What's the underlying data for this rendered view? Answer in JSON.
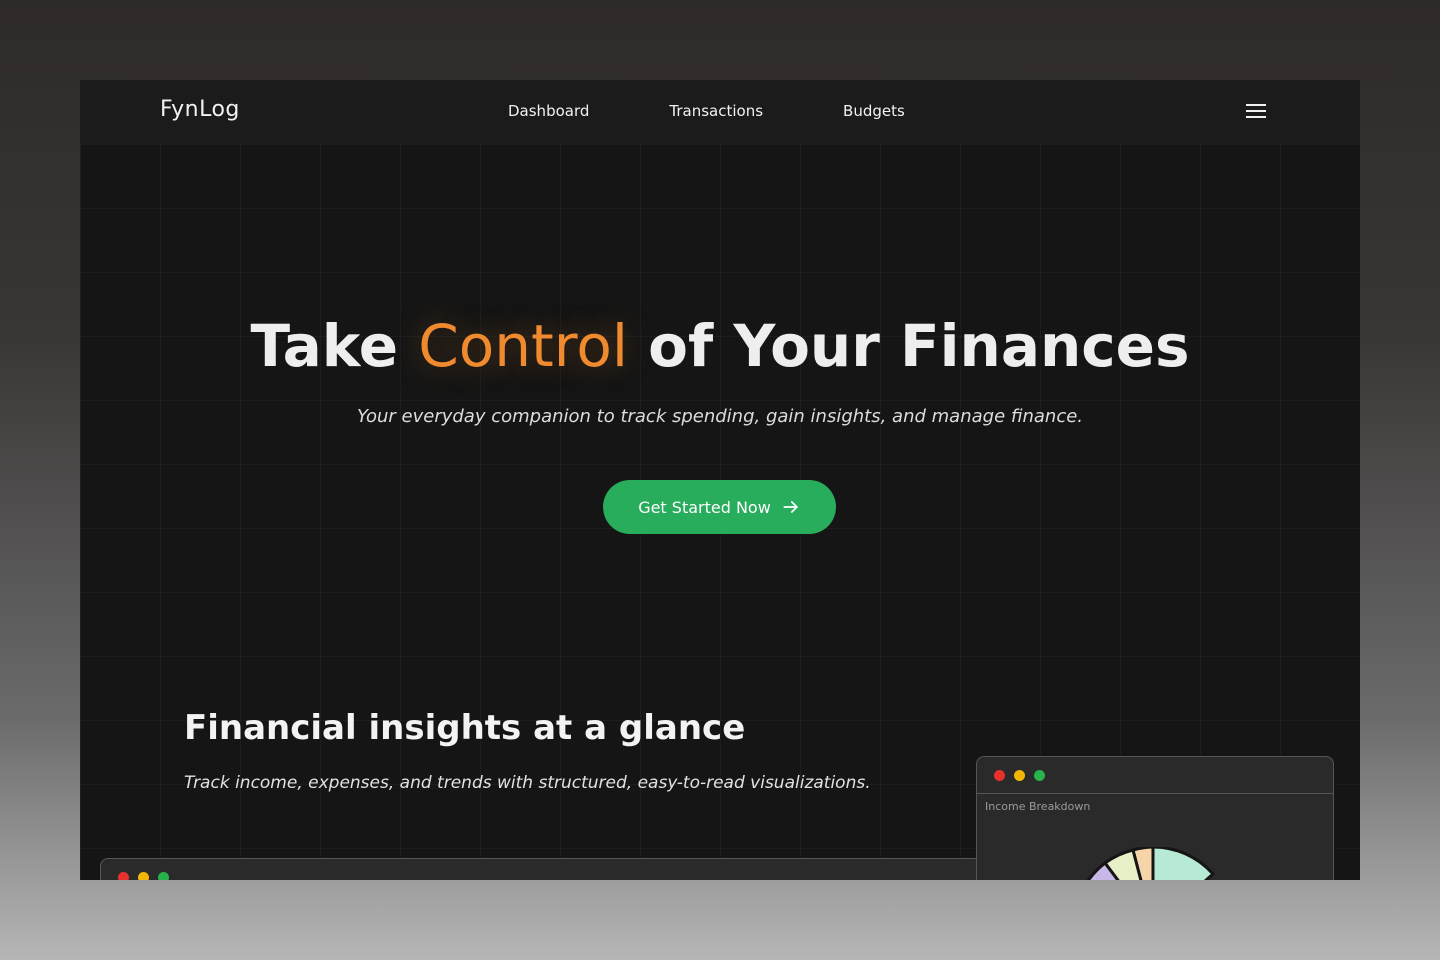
{
  "nav": {
    "logo": "FynLog",
    "links": [
      "Dashboard",
      "Transactions",
      "Budgets"
    ],
    "menu_icon": "hamburger-menu-icon"
  },
  "hero": {
    "title_before": "Take",
    "title_accent": "Control",
    "title_after": "of Your Finances",
    "subtitle": "Your everyday companion to track spending, gain insights, and manage finance.",
    "cta_label": "Get Started Now",
    "cta_icon": "arrow-right-icon"
  },
  "section": {
    "title": "Financial insights at a glance",
    "subtitle": "Track income, expenses, and trends with structured, easy-to-read visualizations."
  },
  "income_window": {
    "label": "Income Breakdown"
  },
  "colors": {
    "accent": "#ef8a2e",
    "cta": "#27ad5c",
    "dot_red": "#e8302f",
    "dot_yellow": "#f2b705",
    "dot_green": "#27b24a",
    "pie": [
      "#b6ead4",
      "#f4d4a8",
      "#e6efc6",
      "#c8b8e8"
    ]
  }
}
